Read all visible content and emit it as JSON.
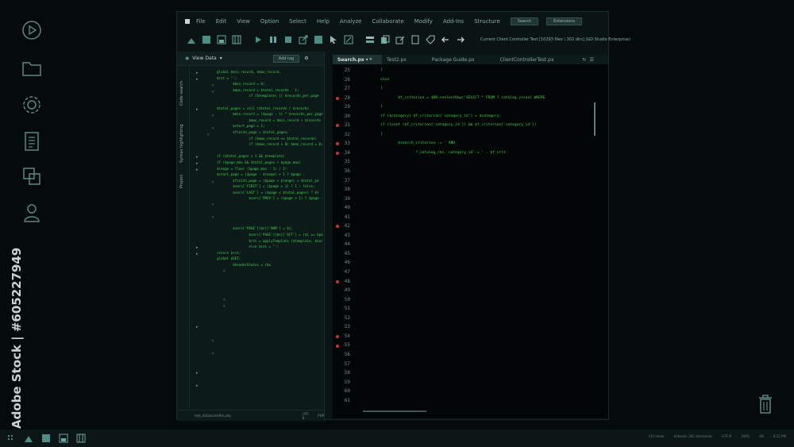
{
  "desktop": {
    "watermark_text": "Adobe Stock | #605227949",
    "icons": [
      "play-circle-icon",
      "folder-icon",
      "gear-icon",
      "document-icon",
      "layers-icon",
      "user-icon",
      "trash-icon"
    ]
  },
  "menubar": {
    "items": [
      "File",
      "Edit",
      "View",
      "Option",
      "Select",
      "Help",
      "Analyze",
      "Collaborate",
      "Modify",
      "Add-Ins",
      "Structure"
    ],
    "chips": [
      "Search",
      "Extensions"
    ]
  },
  "toolbar": {
    "title": "Current Client Controller Test [10293 files \\ 302 dirs] (GD Studio Enterprise)"
  },
  "left_panel": {
    "header": "View Data",
    "chip": "Add tag",
    "vertical_tabs": [
      "Code search",
      "Syntax highlighting",
      "Project"
    ],
    "code": "global $min_record, $max_record,\n$rst = '';\n        $min_record = 0;\n        $max_record = $total_records - 1;\n                if ($template) || $records_per_page\n\n$total_pages = ceil ($total_records / $records\n        $min_record = ($page - 1) * $records_per_page\n                $max_record = $min_record + $records\n        $start_page = 1;\n        $finish_page = $total_pages;\n                if ($max_record >= $total_records)\n                if ($max_record < 0) $max_record = 0;\n\nif ($total_pages > 1 && $template)\nif ($page_max && $total_pages > $page_max)\n$range = floor ($page_max - 1) / 2;\n$start_page = ($page - $range) > 1 ? $page -\n        $finish_page = ($page + $range) > $total_pa\n        $vars['FIRST'] = ($page > 1) ? 1 : false;\n        $vars['LAST'] = ($page < $total_pages) ? $t\n                $vars['PREV'] = ($page > 1) ? $page -\n\n\n\n\n        $vars['PAGE'][$n]['NUM'] = $i;\n                $vars['PAGE'][$n]['ACT'] = ($i == $page)\n                $rst = applyTemplate ($template, $var\n                else $rst = '';\nreturn $rst;\nglobal $SET;\n        $headerStatus = (bo",
    "status_left": "test_data/somefile.php",
    "status_mid": "UTF-8",
    "status_right": "PHP"
  },
  "editor": {
    "tabs": [
      "Search.px",
      "Test2.px",
      "Package Guide.px",
      "ClientControllerTest.px"
    ],
    "line_numbers": [
      "25",
      "26",
      "27",
      "28",
      "29",
      "30",
      "31",
      "32",
      "33",
      "34",
      "35",
      "36",
      "37",
      "38",
      "39",
      "40",
      "41",
      "42",
      "43",
      "44",
      "45",
      "46",
      "47",
      "48",
      "49",
      "50",
      "51",
      "52",
      "53",
      "54",
      "55",
      "56",
      "57",
      "58",
      "59",
      "60",
      "61"
    ],
    "breakpoint_lines": [
      "28",
      "31",
      "33",
      "34",
      "42",
      "48",
      "54",
      "55"
    ],
    "code": "        }\n        else\n        {\n                $f_criterion = $DB->selectRow('SELECT * FROM ?_catalog_visual WHERE\n        }\n        if ($category) $f_criterion['category_id'] = $category;\n        if (isset ($f_criterion['category_id']) && $f_criterion['category_id'])\n        {\n                $search_criterion .= ' AND\n                        ?_catalog_rec.`category_id` = ' . $f_crit"
  },
  "taskbar": {
    "tray": [
      "Ctrl mode",
      "Indexed: 302 directories",
      "UTF-8",
      "100%",
      "EN",
      "8:12 PM"
    ]
  }
}
